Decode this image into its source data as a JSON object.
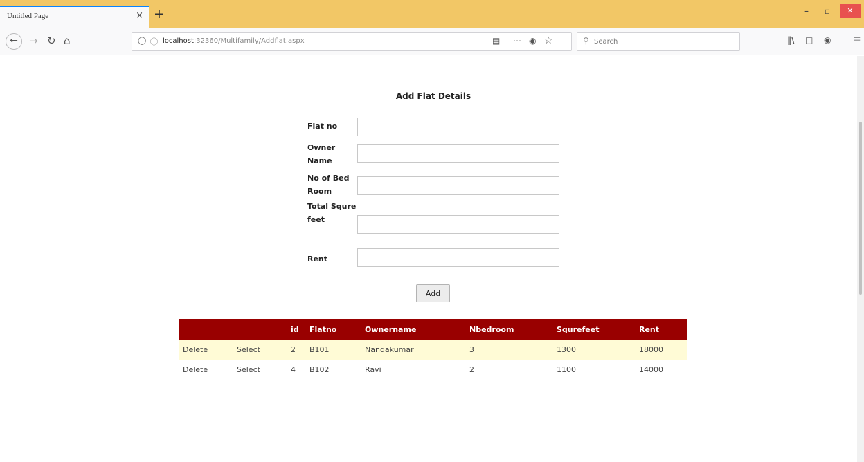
{
  "browser": {
    "tab_title": "Untitled Page",
    "tab_close": "×",
    "new_tab": "+",
    "window_controls": {
      "minimize": "–",
      "maximize": "▫",
      "close": "✕"
    },
    "url_host": "localhost",
    "url_path": ":32360/Multifamily/Addflat.aspx",
    "search_placeholder": "Search",
    "icons": [
      "back-icon",
      "forward-icon",
      "reload-icon",
      "home-icon",
      "shield-icon",
      "info-icon",
      "reader-icon",
      "more-icon",
      "pocket-icon",
      "star-icon",
      "search-icon",
      "library-icon",
      "sidebar-icon",
      "account-icon",
      "menu-icon"
    ]
  },
  "form": {
    "heading": "Add Flat Details",
    "fields": [
      {
        "label": "Flat no",
        "value": ""
      },
      {
        "label": "Owner Name",
        "value": ""
      },
      {
        "label": "No of Bed Room",
        "value": ""
      },
      {
        "label": "Total Squre feet",
        "value": ""
      },
      {
        "label": "Rent",
        "value": ""
      }
    ],
    "submit_label": "Add"
  },
  "grid": {
    "header_color": "#990000",
    "alt_row_color": "#fffbd6",
    "columns": [
      "",
      "",
      "id",
      "Flatno",
      "Ownername",
      "Nbedroom",
      "Squrefeet",
      "Rent"
    ],
    "rows": [
      {
        "delete": "Delete",
        "select": "Select",
        "id": "2",
        "flatno": "B101",
        "ownername": "Nandakumar",
        "nbedroom": "3",
        "squrefeet": "1300",
        "rent": "18000"
      },
      {
        "delete": "Delete",
        "select": "Select",
        "id": "4",
        "flatno": "B102",
        "ownername": "Ravi",
        "nbedroom": "2",
        "squrefeet": "1100",
        "rent": "14000"
      }
    ]
  }
}
